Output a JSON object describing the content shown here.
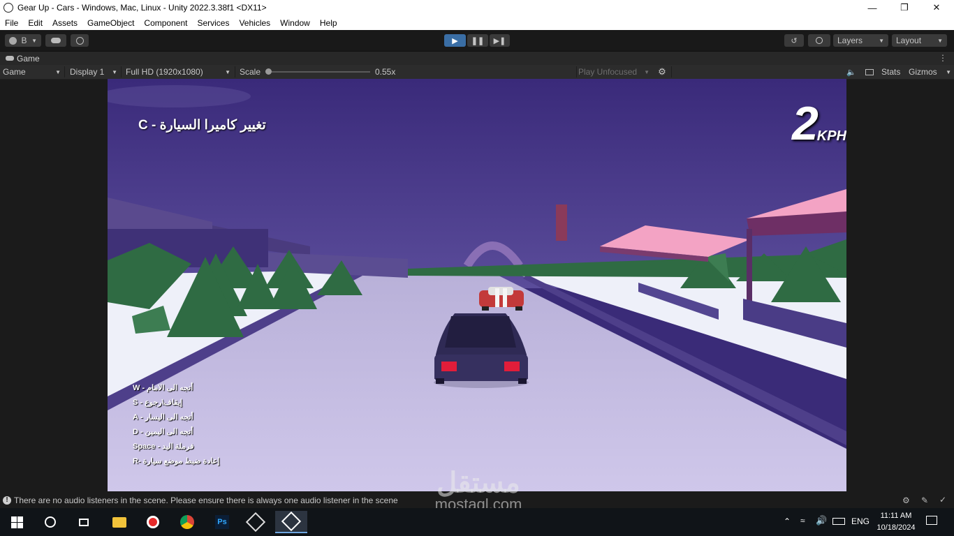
{
  "window": {
    "title": "Gear Up - Cars - Windows, Mac, Linux - Unity 2022.3.38f1 <DX11>",
    "controls": [
      "minimize",
      "maximize",
      "close"
    ]
  },
  "menu": [
    "File",
    "Edit",
    "Assets",
    "GameObject",
    "Component",
    "Services",
    "Vehicles",
    "Window",
    "Help"
  ],
  "toolbar": {
    "account_label": "B",
    "layers_label": "Layers",
    "layout_label": "Layout",
    "play_active": true
  },
  "panel": {
    "tab_label": "Game"
  },
  "gamebar": {
    "mode": "Game",
    "display": "Display 1",
    "resolution": "Full HD (1920x1080)",
    "scale_label": "Scale",
    "scale_value": "0.55x",
    "play_focus": "Play Unfocused",
    "stats": "Stats",
    "gizmos": "Gizmos"
  },
  "hud": {
    "camera_hint": "تغيير كاميرا السيارة - C",
    "speed_value": "2",
    "speed_unit": "KPH",
    "controls": [
      "أتجه الى الامام - W",
      "إيقاف\\رجوع - S",
      "أتجه الى اليسار - A",
      "أتجه الى اليمين - D",
      "فرملة اليد - Space",
      "إعادة ضبط موضع سيارة -R"
    ]
  },
  "status": {
    "message": "There are no audio listeners in the scene. Please ensure there is always one audio listener in the scene"
  },
  "watermark": {
    "arabic": "مستقل",
    "latin": "mostaql.com"
  },
  "taskbar": {
    "language": "ENG",
    "time": "11:11 AM",
    "date": "10/18/2024",
    "apps": [
      "file-explorer",
      "screen-recorder",
      "chrome",
      "photoshop",
      "unity-hub",
      "unity-editor"
    ]
  },
  "colors": {
    "accent": "#3a6ea5",
    "sky": "#3c2d7c",
    "road": "#c9c0e4",
    "snow": "#f4f4fb",
    "tree": "#2f6b43",
    "canopy": "#f7a0c0"
  }
}
